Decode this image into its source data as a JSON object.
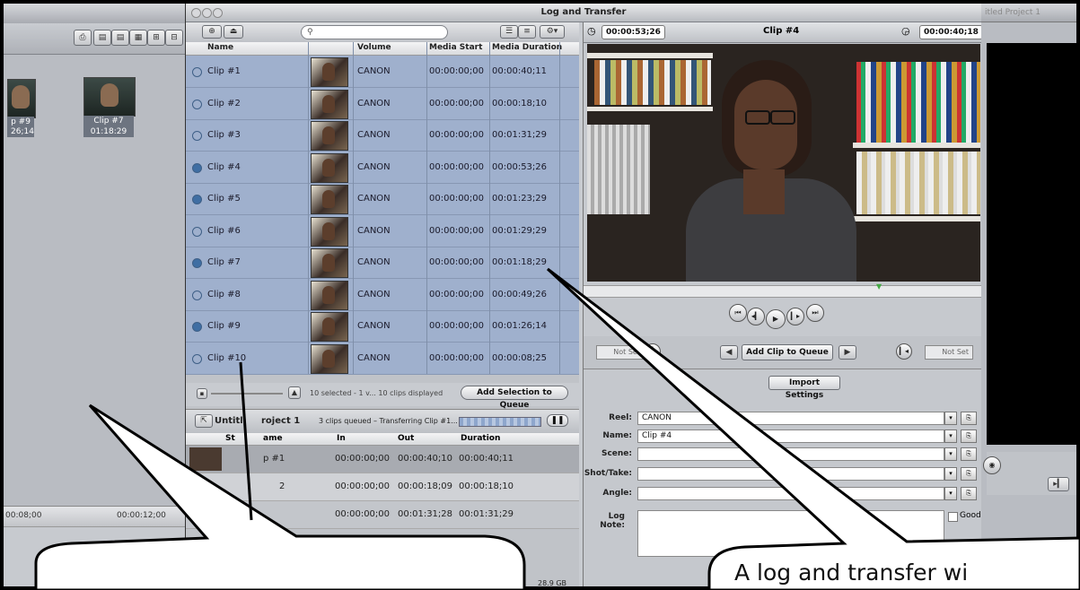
{
  "left_window": {
    "clips": [
      {
        "label": "p #9",
        "duration": "26;14"
      },
      {
        "label": "Clip #7",
        "duration": "01:18:29"
      }
    ],
    "timeline_ticks": [
      "00:08;00",
      "00:00:12;00"
    ]
  },
  "log_transfer": {
    "title": "Log and Transfer",
    "browser": {
      "search_placeholder": "",
      "columns": {
        "name": "Name",
        "volume": "Volume",
        "media_start": "Media Start",
        "media_duration": "Media Duration"
      },
      "clips": [
        {
          "name": "Clip #1",
          "volume": "CANON",
          "start": "00:00:00;00",
          "duration": "00:00:40;11",
          "queued": false
        },
        {
          "name": "Clip #2",
          "volume": "CANON",
          "start": "00:00:00;00",
          "duration": "00:00:18;10",
          "queued": false
        },
        {
          "name": "Clip #3",
          "volume": "CANON",
          "start": "00:00:00;00",
          "duration": "00:01:31;29",
          "queued": false
        },
        {
          "name": "Clip #4",
          "volume": "CANON",
          "start": "00:00:00;00",
          "duration": "00:00:53;26",
          "queued": true
        },
        {
          "name": "Clip #5",
          "volume": "CANON",
          "start": "00:00:00;00",
          "duration": "00:01:23;29",
          "queued": true
        },
        {
          "name": "Clip #6",
          "volume": "CANON",
          "start": "00:00:00;00",
          "duration": "00:01:29;29",
          "queued": false
        },
        {
          "name": "Clip #7",
          "volume": "CANON",
          "start": "00:00:00;00",
          "duration": "00:01:18;29",
          "queued": true
        },
        {
          "name": "Clip #8",
          "volume": "CANON",
          "start": "00:00:00;00",
          "duration": "00:00:49;26",
          "queued": false
        },
        {
          "name": "Clip #9",
          "volume": "CANON",
          "start": "00:00:00;00",
          "duration": "00:01:26;14",
          "queued": true
        },
        {
          "name": "Clip #10",
          "volume": "CANON",
          "start": "00:00:00;00",
          "duration": "00:00:08;25",
          "queued": false
        }
      ],
      "status": "10 selected - 1 v... 10 clips displayed",
      "add_selection_label": "Add Selection to Queue"
    },
    "queue": {
      "project": "Untitl",
      "project_rest": "roject 1",
      "status": "3 clips queued – Transferring Clip #1...",
      "columns": {
        "status": "St",
        "name": "ame",
        "in": "In",
        "out": "Out",
        "duration": "Duration"
      },
      "rows": [
        {
          "name": "p #1",
          "in": "00:00:00;00",
          "out": "00:00:40;10",
          "duration": "00:00:40;11"
        },
        {
          "name": "2",
          "in": "00:00:00;00",
          "out": "00:00:18;09",
          "duration": "00:00:18;10"
        },
        {
          "name": "",
          "in": "00:00:00;00",
          "out": "00:01:31;28",
          "duration": "00:01:31;29"
        }
      ],
      "disk": "28.9 GB"
    },
    "viewer": {
      "timecode_left": "00:00:53;26",
      "clip_title": "Clip #4",
      "timecode_right": "00:00:40;18",
      "not_set_in": "Not Set",
      "not_set_out": "Not Set",
      "add_clip_label": "Add Clip to Queue",
      "import_settings_label": "Import Settings",
      "fields": {
        "reel_label": "Reel:",
        "reel_value": "CANON",
        "name_label": "Name:",
        "name_value": "Clip #4",
        "scene_label": "Scene:",
        "shot_label": "Shot/Take:",
        "angle_label": "Angle:",
        "log_note_label": "Log Note:",
        "good_label": "Good"
      }
    }
  },
  "right_window": {
    "title": "itled Project 1"
  },
  "captions": {
    "right": "A log and transfer wi"
  }
}
